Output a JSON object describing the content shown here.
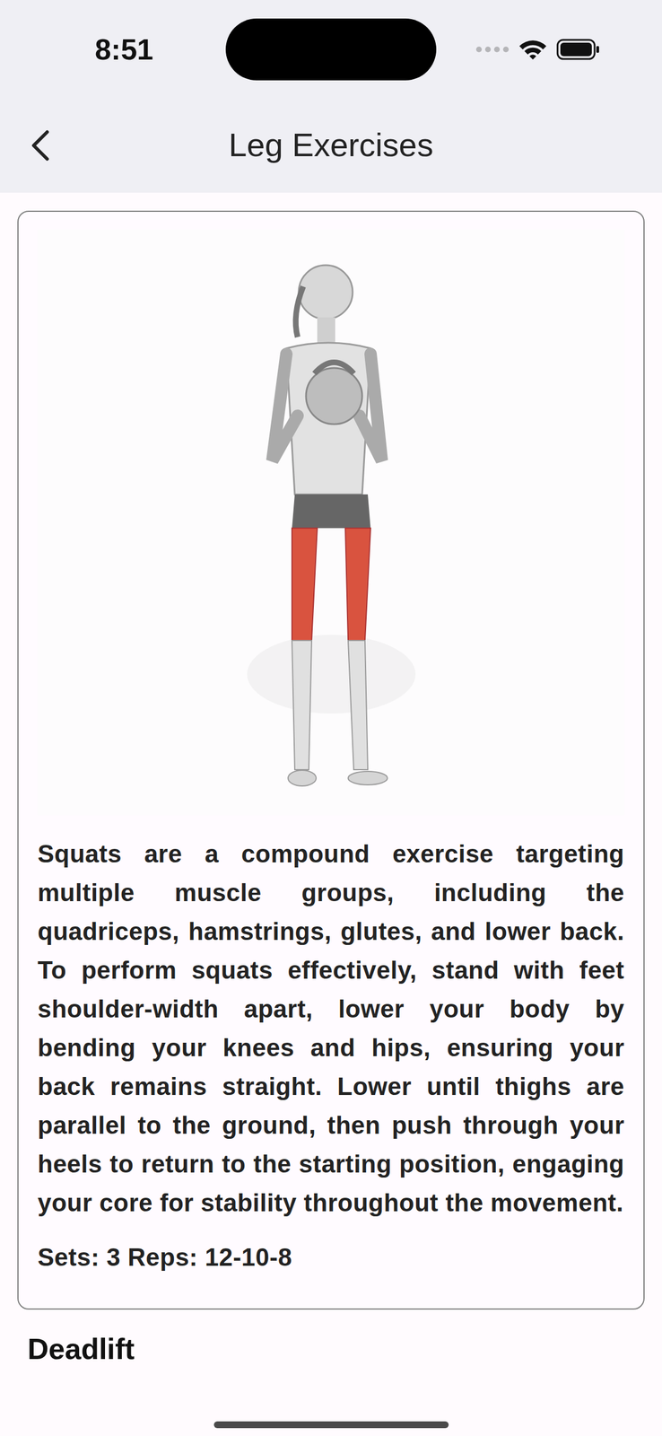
{
  "status_bar": {
    "time": "8:51"
  },
  "header": {
    "title": "Leg Exercises"
  },
  "cards": [
    {
      "description": "Squats are a compound exercise targeting multiple muscle groups, including the quadriceps, hamstrings, glutes, and lower back. To perform squats effectively, stand with feet shoulder-width apart, lower your body by bending your knees and hips, ensuring your back remains straight. Lower until thighs are parallel to the ground, then push through your heels to return to the starting position, engaging your core for stability throughout the movement.",
      "sets": "Sets: 3 Reps: 12-10-8"
    }
  ],
  "next_section": {
    "title": "Deadlift"
  }
}
